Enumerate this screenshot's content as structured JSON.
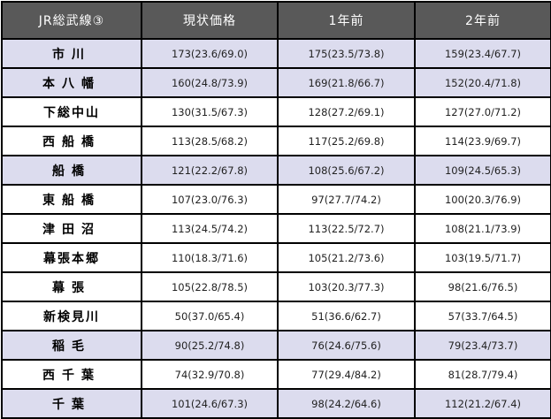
{
  "colors": {
    "header_bg": "#595959",
    "header_text": "#ffffff",
    "highlight_row_bg": "#dcdcee",
    "plain_row_bg": "#ffffff",
    "border": "#000000"
  },
  "table": {
    "headers": {
      "line": "JR総武線③",
      "now": "現状価格",
      "one_year": "1年前",
      "two_years": "2年前"
    },
    "rows": [
      {
        "station": "市川",
        "highlight": true,
        "now": "173(23.6/69.0)",
        "one_year": "175(23.5/73.8)",
        "two_years": "159(23.4/67.7)"
      },
      {
        "station": "本八幡",
        "highlight": true,
        "now": "160(24.8/73.9)",
        "one_year": "169(21.8/66.7)",
        "two_years": "152(20.4/71.8)"
      },
      {
        "station": "下総中山",
        "highlight": false,
        "now": "130(31.5/67.3)",
        "one_year": "128(27.2/69.1)",
        "two_years": "127(27.0/71.2)"
      },
      {
        "station": "西船橋",
        "highlight": false,
        "now": "113(28.5/68.2)",
        "one_year": "117(25.2/69.8)",
        "two_years": "114(23.9/69.7)"
      },
      {
        "station": "船橋",
        "highlight": true,
        "now": "121(22.2/67.8)",
        "one_year": "108(25.6/67.2)",
        "two_years": "109(24.5/65.3)"
      },
      {
        "station": "東船橋",
        "highlight": false,
        "now": "107(23.0/76.3)",
        "one_year": "97(27.7/74.2)",
        "two_years": "100(20.3/76.9)"
      },
      {
        "station": "津田沼",
        "highlight": false,
        "now": "113(24.5/74.2)",
        "one_year": "113(22.5/72.7)",
        "two_years": "108(21.1/73.9)"
      },
      {
        "station": "幕張本郷",
        "highlight": false,
        "now": "110(18.3/71.6)",
        "one_year": "105(21.2/73.6)",
        "two_years": "103(19.5/71.7)"
      },
      {
        "station": "幕張",
        "highlight": false,
        "now": "105(22.8/78.5)",
        "one_year": "103(20.3/77.3)",
        "two_years": "98(21.6/76.5)"
      },
      {
        "station": "新検見川",
        "highlight": false,
        "now": "50(37.0/65.4)",
        "one_year": "51(36.6/62.7)",
        "two_years": "57(33.7/64.5)"
      },
      {
        "station": "稲毛",
        "highlight": true,
        "now": "90(25.2/74.8)",
        "one_year": "76(24.6/75.6)",
        "two_years": "79(23.4/73.7)"
      },
      {
        "station": "西千葉",
        "highlight": false,
        "now": "74(32.9/70.8)",
        "one_year": "77(29.4/84.2)",
        "two_years": "81(28.7/79.4)"
      },
      {
        "station": "千葉",
        "highlight": true,
        "now": "101(24.6/67.3)",
        "one_year": "98(24.2/64.6)",
        "two_years": "112(21.2/67.4)"
      }
    ]
  }
}
